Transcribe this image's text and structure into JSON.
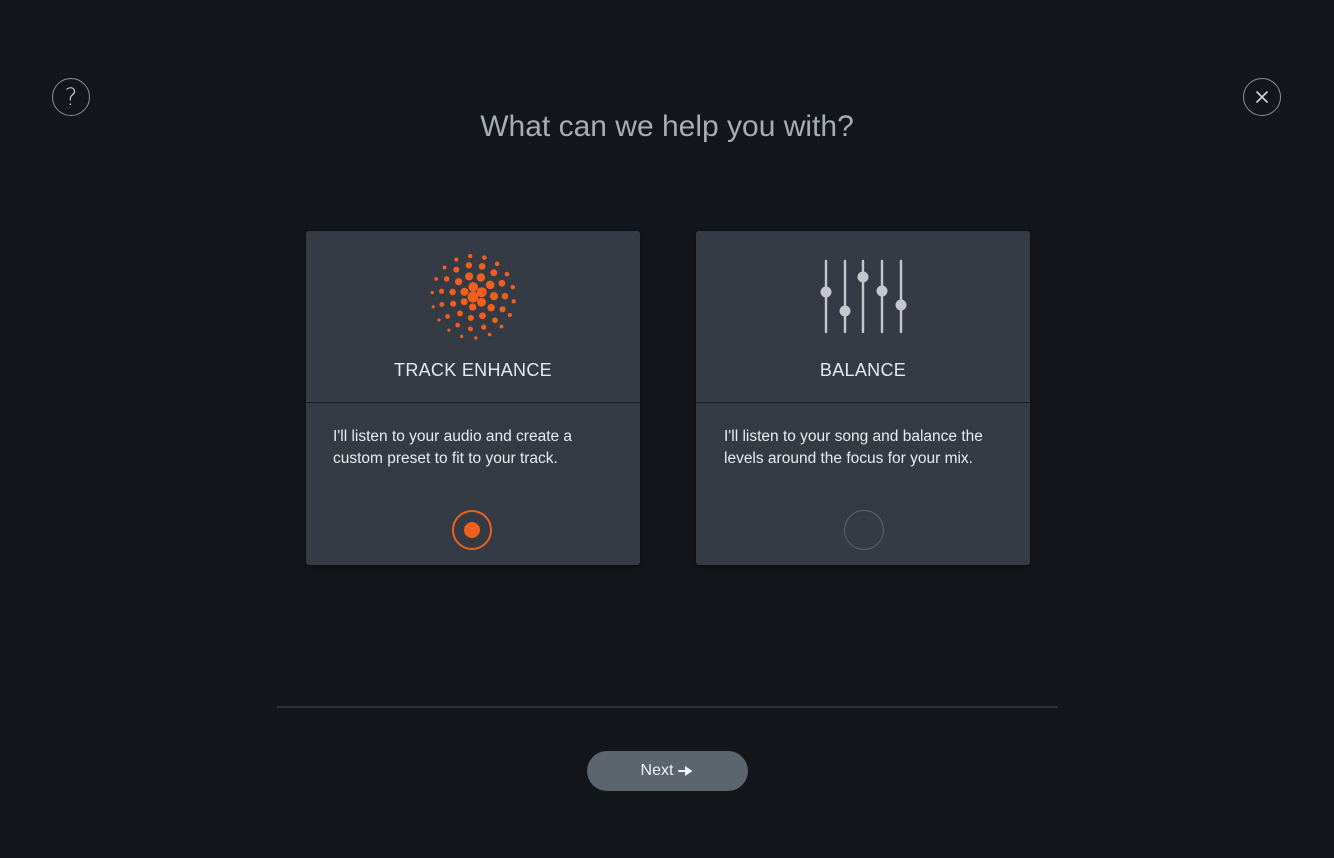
{
  "header": {
    "title": "What can we help you with?",
    "help_icon": "question-mark-icon",
    "help_glyph": "?",
    "close_icon": "close-icon"
  },
  "options": [
    {
      "title": "TRACK ENHANCE",
      "icon": "dot-sphere-icon",
      "description": "I'll listen to your audio and create a custom preset to fit to your track.",
      "selected": true
    },
    {
      "title": "BALANCE",
      "icon": "mixer-faders-icon",
      "description": "I'll listen to your song and balance the levels around the focus for your mix.",
      "selected": false
    }
  ],
  "footer": {
    "next_label": "Next",
    "next_icon": "arrow-right-icon"
  },
  "colors": {
    "accent": "#f15f1e",
    "background": "#13161b",
    "card": "#353b44",
    "button": "#5c646e"
  }
}
